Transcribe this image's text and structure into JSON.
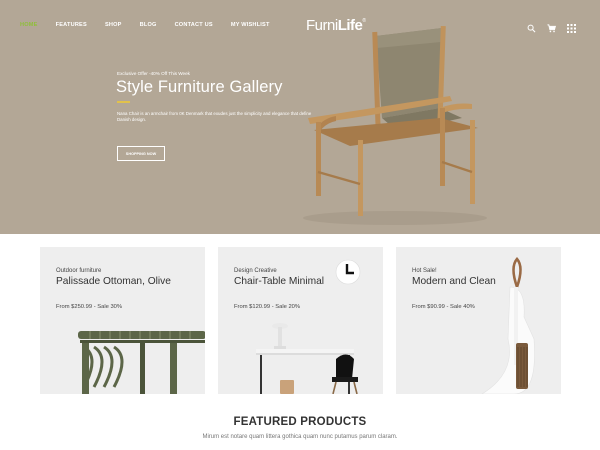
{
  "nav": {
    "items": [
      "HOME",
      "FEATURES",
      "SHOP",
      "BLOG",
      "CONTACT US",
      "MY WISHLIST"
    ]
  },
  "logo": {
    "light": "Furni",
    "bold": "Life",
    "mark": "®"
  },
  "header_icons": [
    "search-icon",
    "cart-icon",
    "grid-menu-icon"
  ],
  "hero": {
    "eyebrow": "Exclusive Offer -40% Off This Week",
    "title": "Style Furniture Gallery",
    "text": "Nana Chair is an armchair from 0K Denmark that exudes just the simplicity and elegance that define Danish design.",
    "button": "SHOPPING NOW",
    "accent_color": "#e2c24b",
    "background": "#b3a796"
  },
  "cards": [
    {
      "sub": "Outdoor furniture",
      "title": "Palissade Ottoman, Olive",
      "price": "From  $250.99 - Sale 30%"
    },
    {
      "sub": "Design Creative",
      "title": "Chair-Table Minimal",
      "price": "From  $120.99 - Sale 20%"
    },
    {
      "sub": "Hot Sale!",
      "title": "Modern and Clean",
      "price": "From  $90.99 - Sale 40%"
    }
  ],
  "featured": {
    "title": "FEATURED PRODUCTS",
    "subtitle": "Mirum est notare quam littera gothica quam nunc putamus parum claram."
  },
  "colors": {
    "nav_active": "#8fbf3a"
  }
}
